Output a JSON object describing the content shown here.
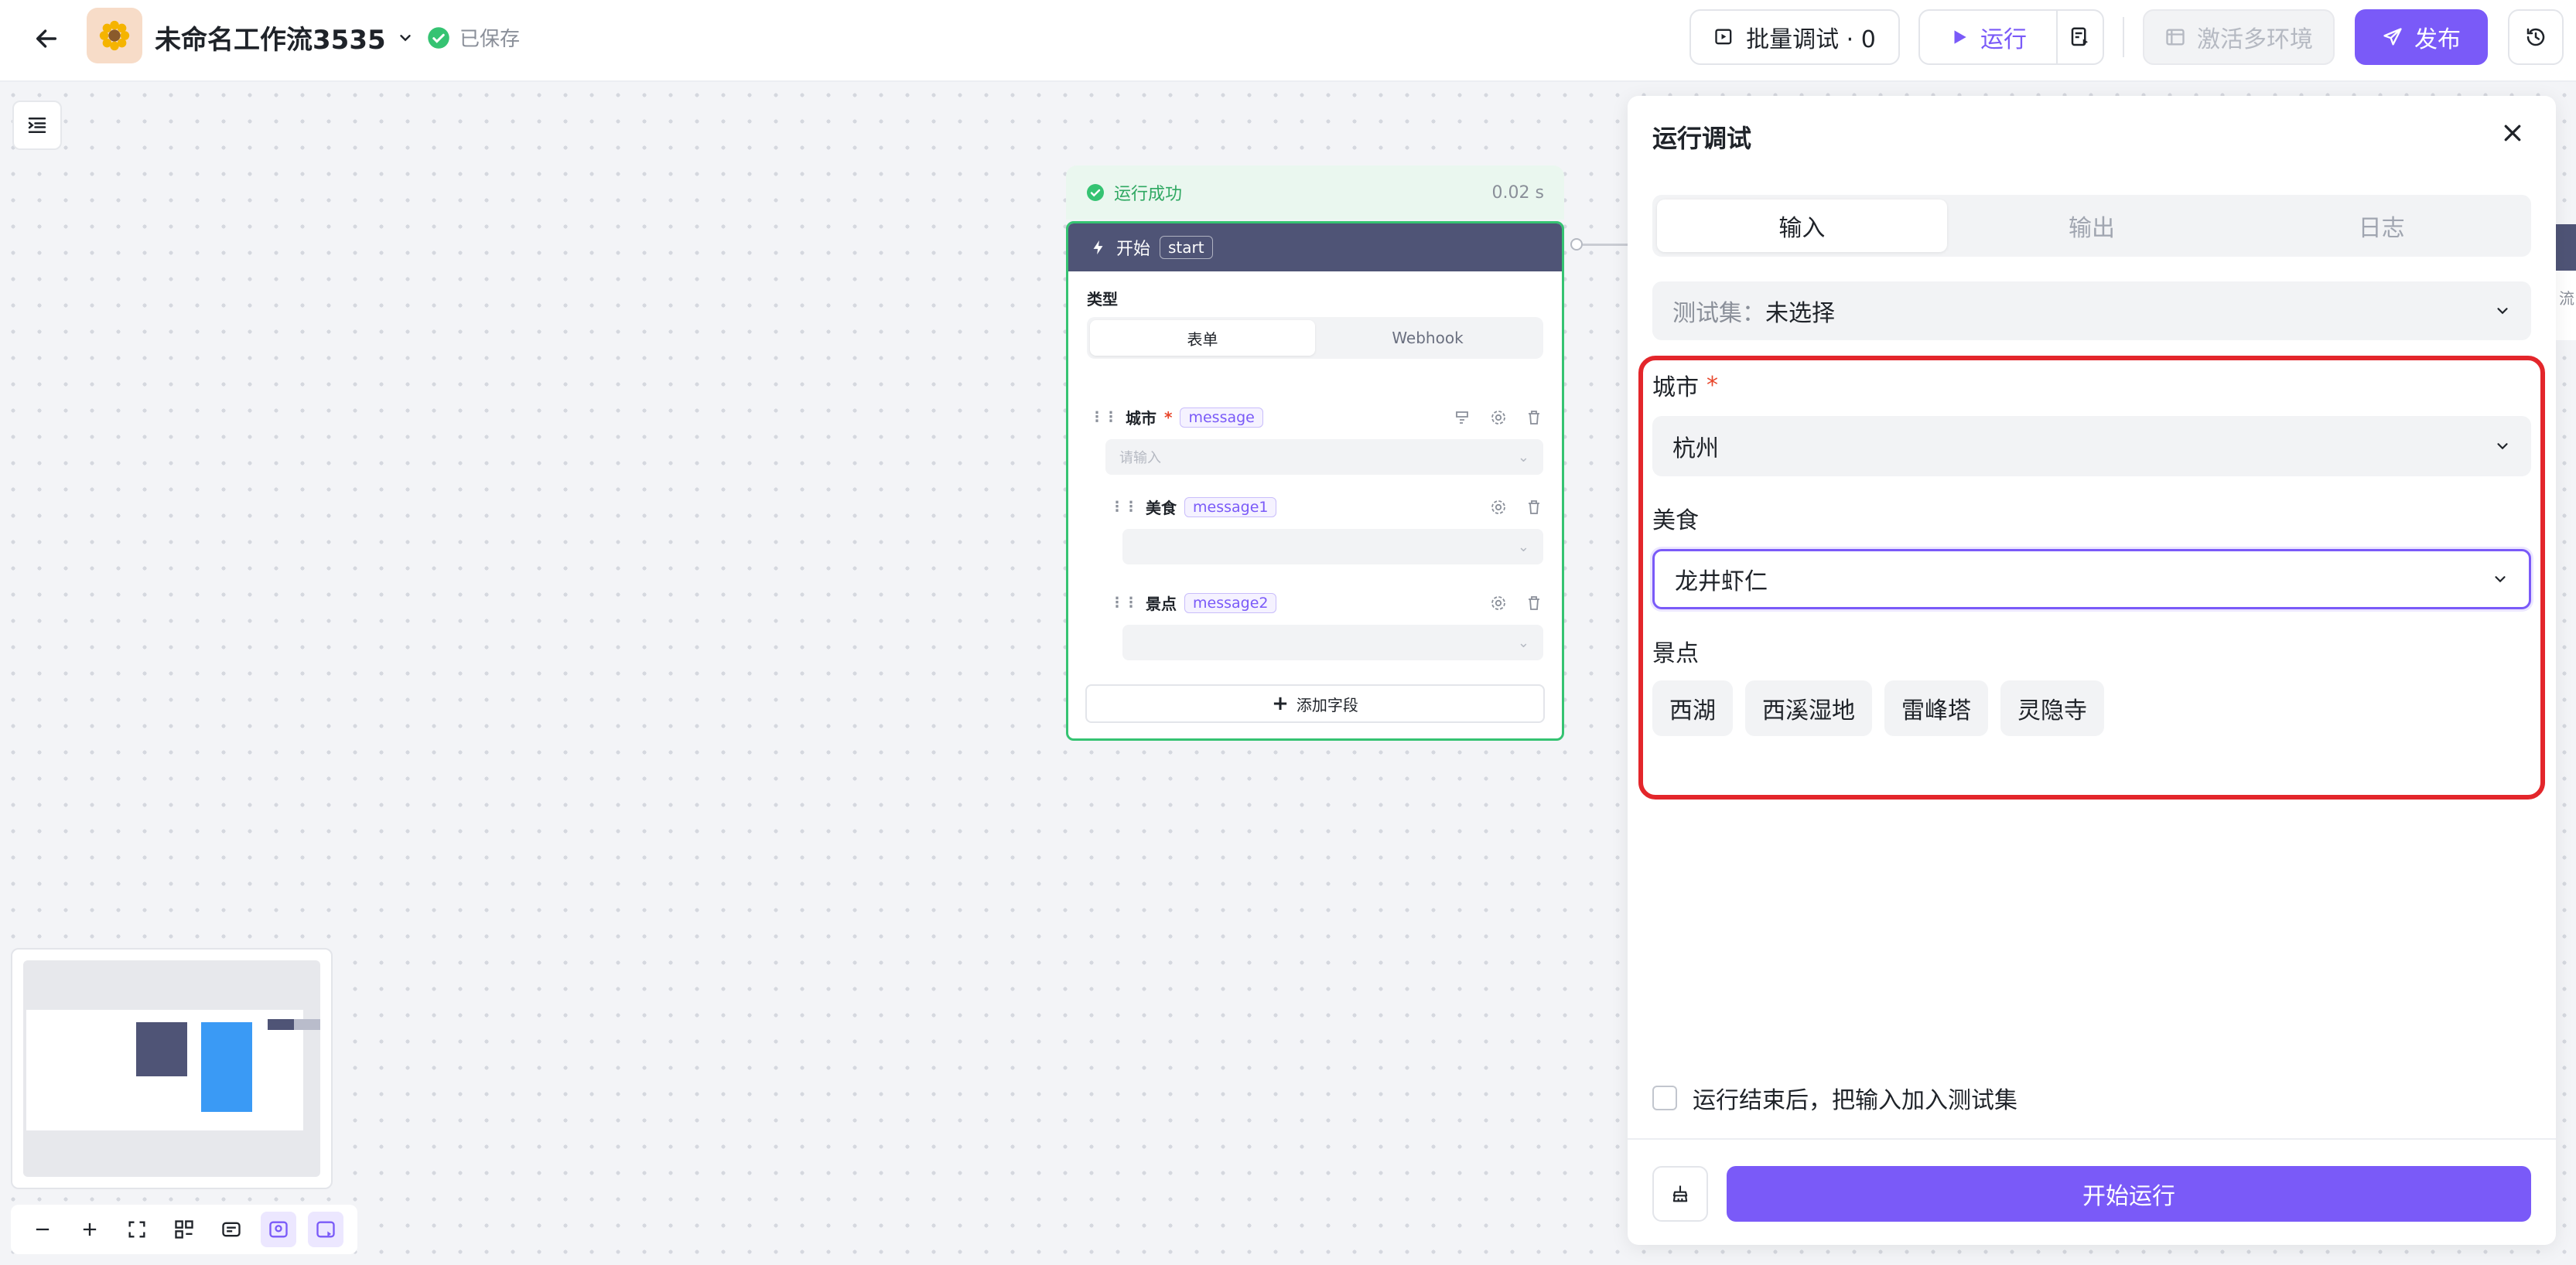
{
  "header": {
    "app_name": "未命名工作流3535",
    "saved_status": "已保存",
    "batch_debug_label": "批量调试 · 0",
    "run_label": "运行",
    "activate_env_label": "激活多环境",
    "publish_label": "发布"
  },
  "node": {
    "status_text": "运行成功",
    "duration": "0.02 s",
    "title": "开始",
    "tag": "start",
    "type_label": "类型",
    "type_options": [
      "表单",
      "Webhook"
    ],
    "fields": [
      {
        "name": "城市",
        "param": "message",
        "placeholder": "请输入"
      },
      {
        "name": "美食",
        "param": "message1"
      },
      {
        "name": "景点",
        "param": "message2"
      }
    ],
    "add_field_label": "添加字段"
  },
  "panel": {
    "title": "运行调试",
    "tabs": [
      "输入",
      "输出",
      "日志"
    ],
    "active_tab": "输入",
    "testset_label": "测试集：",
    "testset_value": "未选择",
    "fields": {
      "city": {
        "label": "城市",
        "value": "杭州",
        "required_mark": "*"
      },
      "food": {
        "label": "美食",
        "value": "龙井虾仁"
      },
      "sights": {
        "label": "景点",
        "options": [
          "西湖",
          "西溪湿地",
          "雷峰塔",
          "灵隐寺"
        ]
      }
    },
    "add_to_testset_label": "运行结束后，把输入加入测试集",
    "start_run_label": "开始运行"
  },
  "right_peek_text": "流",
  "colors": {
    "accent": "#7a5af8",
    "success": "#35c372",
    "node_header": "#4f5476",
    "highlight": "#e3262b"
  }
}
